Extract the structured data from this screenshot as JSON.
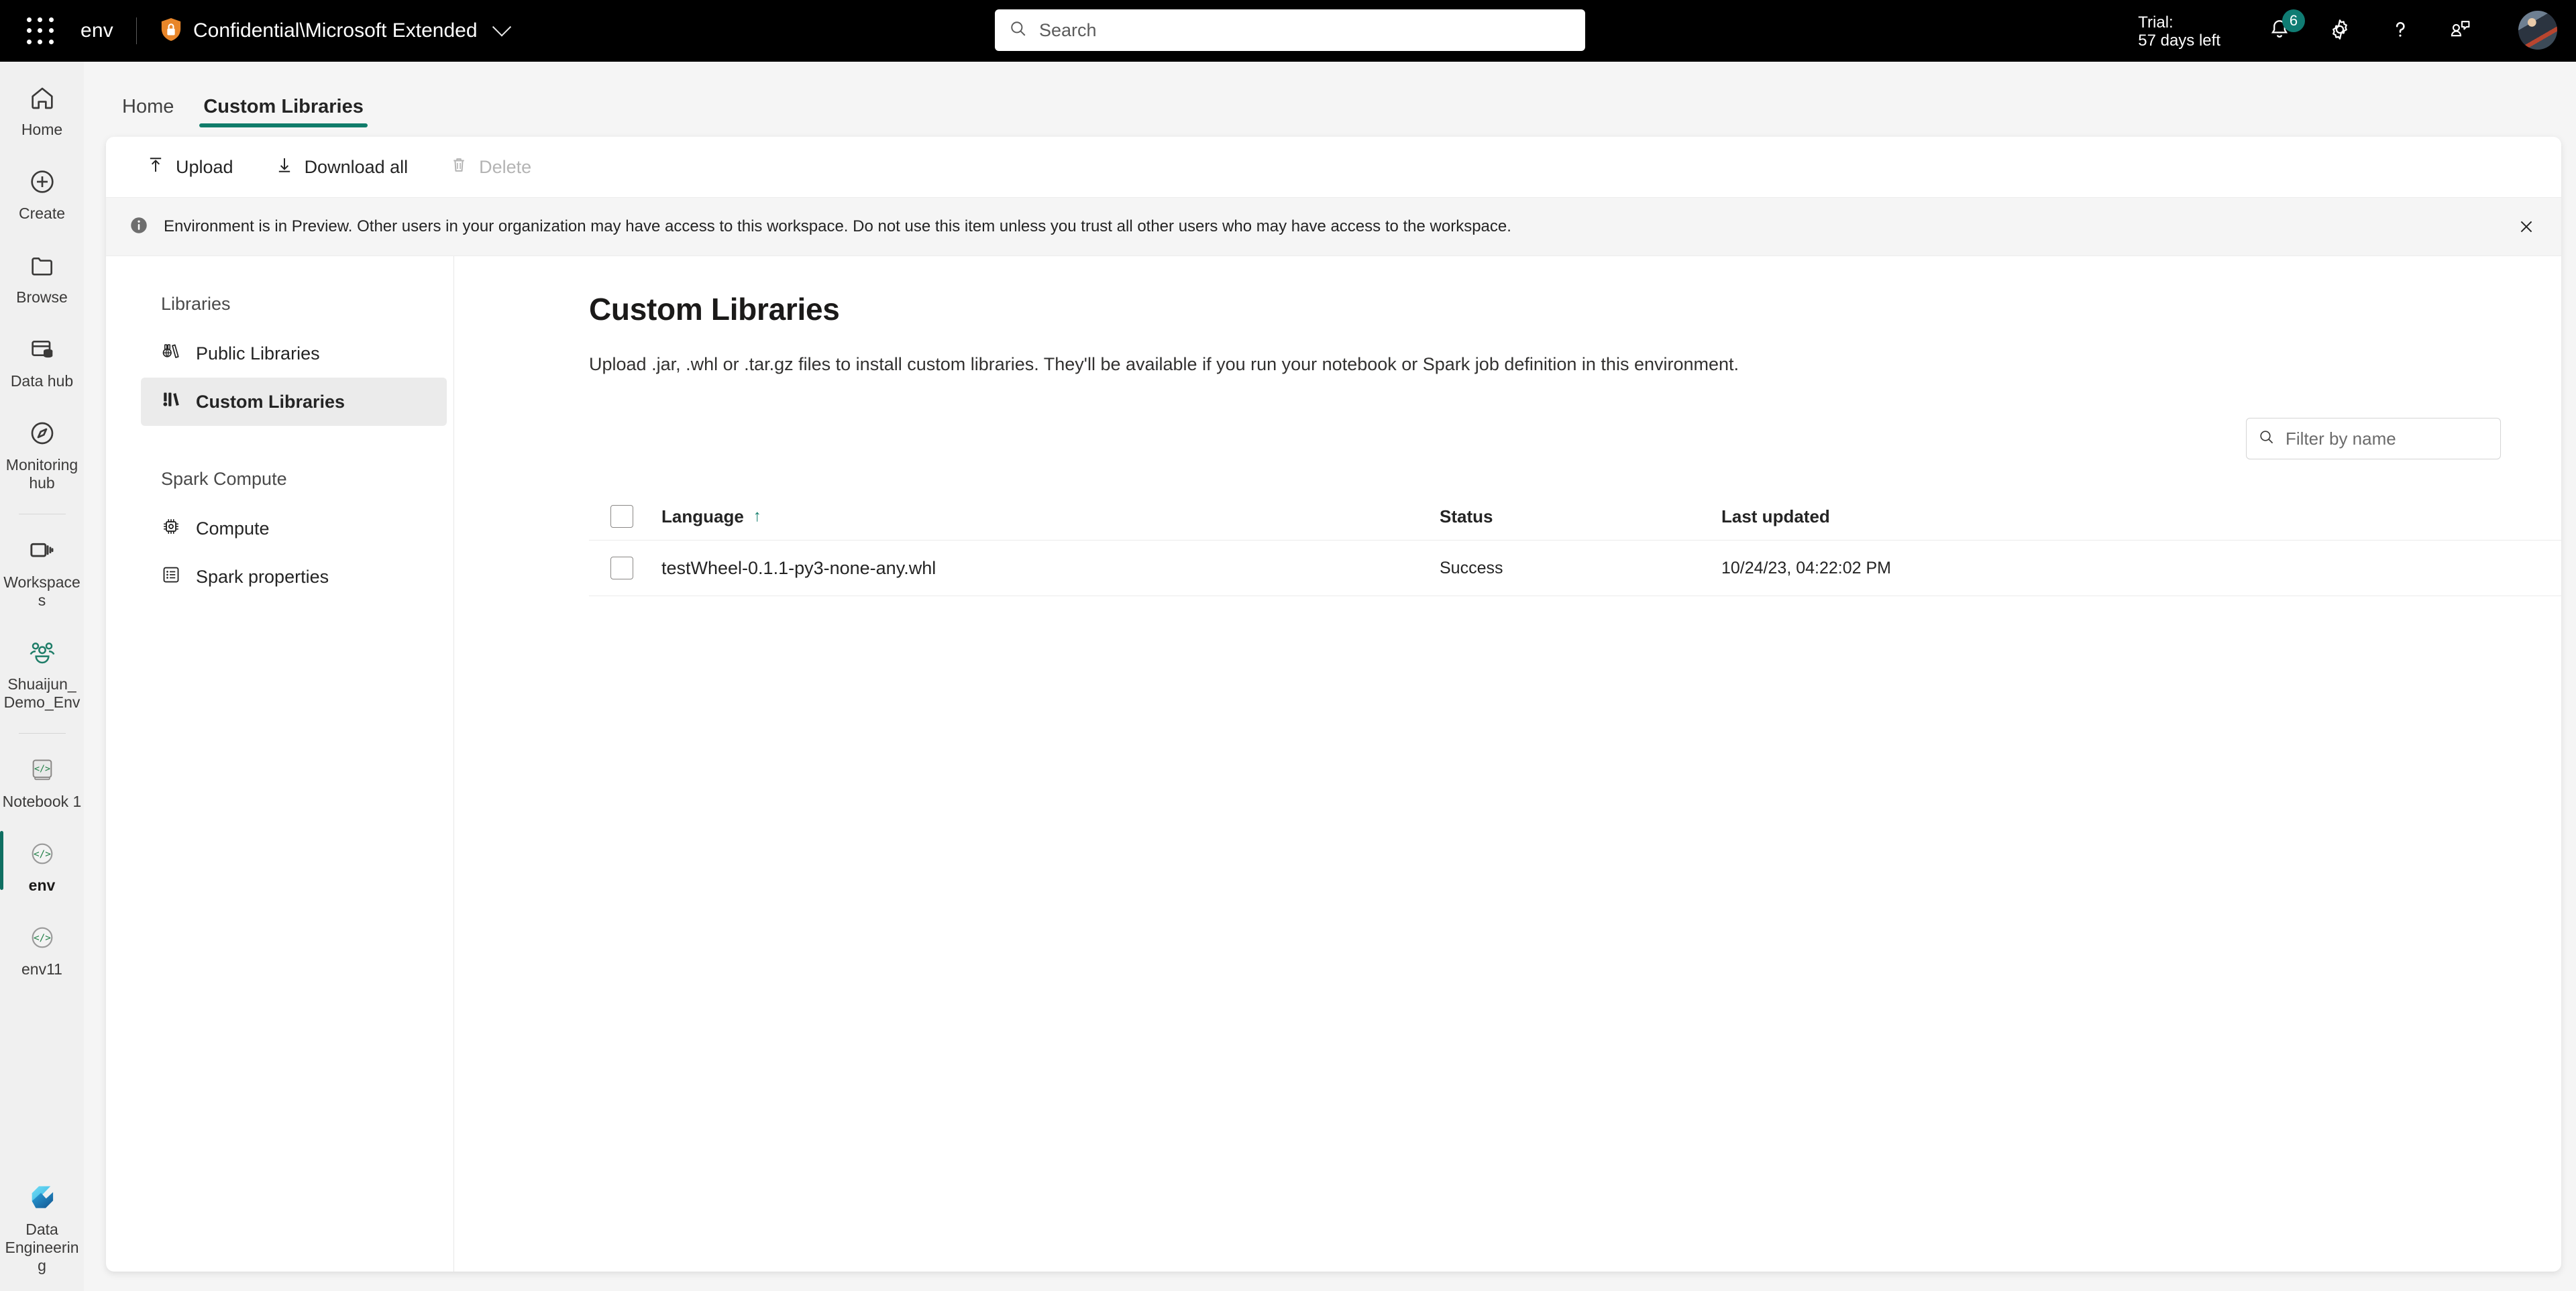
{
  "topbar": {
    "waffle_icon": "app-launcher-icon",
    "app_name": "env",
    "sensitivity_icon": "shield-lock-icon",
    "sensitivity_label": "Confidential\\Microsoft Extended",
    "chevron_icon": "chevron-down-icon",
    "search": {
      "icon": "search-icon",
      "placeholder": "Search",
      "value": ""
    },
    "trial_line1": "Trial:",
    "trial_line2": "57 days left",
    "notifications": {
      "icon": "bell-icon",
      "badge": "6"
    },
    "settings_icon": "gear-icon",
    "help_icon": "question-mark-icon",
    "feedback_icon": "feedback-icon",
    "avatar": "user-avatar"
  },
  "rail": {
    "items": [
      {
        "label": "Home",
        "icon": "home-icon",
        "selected": false
      },
      {
        "label": "Create",
        "icon": "plus-circle-icon",
        "selected": false
      },
      {
        "label": "Browse",
        "icon": "folder-icon",
        "selected": false
      },
      {
        "label": "Data hub",
        "icon": "data-hub-icon",
        "selected": false
      },
      {
        "label": "Monitoring hub",
        "icon": "monitoring-icon",
        "selected": false
      },
      {
        "label": "Workspaces",
        "icon": "workspaces-icon",
        "selected": false
      },
      {
        "label": "Shuaijun_Demo_Env",
        "icon": "people-group-icon",
        "selected": false
      },
      {
        "label": "Notebook 1",
        "icon": "notebook-code-icon",
        "selected": false
      },
      {
        "label": "env",
        "icon": "environment-code-icon",
        "selected": true
      },
      {
        "label": "env11",
        "icon": "environment-code-icon",
        "selected": false
      }
    ],
    "bottom": {
      "label_line1": "Data",
      "label_line2": "Engineering",
      "icon": "fabric-data-engineering-icon"
    }
  },
  "tabs": [
    {
      "label": "Home",
      "active": false
    },
    {
      "label": "Custom Libraries",
      "active": true
    }
  ],
  "toolbar": {
    "upload": {
      "label": "Upload",
      "icon": "upload-icon",
      "disabled": false
    },
    "download_all": {
      "label": "Download all",
      "icon": "download-icon",
      "disabled": false
    },
    "delete": {
      "label": "Delete",
      "icon": "trash-icon",
      "disabled": true
    }
  },
  "banner": {
    "icon": "info-icon",
    "text": "Environment is in Preview. Other users in your organization may have access to this workspace. Do not use this item unless you trust all other users who may have access to the workspace.",
    "close_icon": "close-icon"
  },
  "leftnav": {
    "section_libraries": "Libraries",
    "section_spark": "Spark Compute",
    "items_libraries": [
      {
        "label": "Public Libraries",
        "icon": "public-libraries-icon",
        "active": false
      },
      {
        "label": "Custom Libraries",
        "icon": "custom-libraries-icon",
        "active": true
      }
    ],
    "items_spark": [
      {
        "label": "Compute",
        "icon": "chip-icon",
        "active": false
      },
      {
        "label": "Spark properties",
        "icon": "list-properties-icon",
        "active": false
      }
    ]
  },
  "main": {
    "title": "Custom Libraries",
    "description": "Upload .jar, .whl or .tar.gz files to install custom libraries. They'll be available if you run your notebook or Spark job definition in this environment.",
    "filter": {
      "icon": "search-icon",
      "placeholder": "Filter by name",
      "value": ""
    },
    "table": {
      "columns": [
        {
          "key": "language",
          "label": "Language",
          "sorted": true,
          "sort_icon": "sort-ascending-icon"
        },
        {
          "key": "status",
          "label": "Status",
          "sorted": false
        },
        {
          "key": "last_updated",
          "label": "Last updated",
          "sorted": false
        }
      ],
      "rows": [
        {
          "language": "testWheel-0.1.1-py3-none-any.whl",
          "status": "Success",
          "last_updated": "10/24/23, 04:22:02 PM",
          "selected": false
        }
      ]
    }
  },
  "colors": {
    "accent_teal": "#107c6a",
    "topbar_bg": "#000000",
    "page_bg": "#f5f5f5",
    "card_bg": "#ffffff",
    "badge_bg": "#107c73",
    "shield_orange": "#e8862a"
  }
}
